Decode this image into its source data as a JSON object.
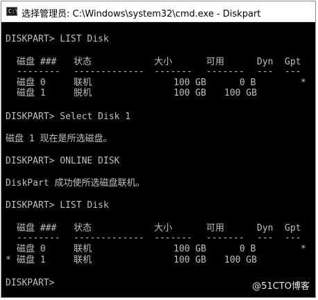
{
  "window": {
    "icon_text": "C:\\",
    "title": "选择管理员: C:\\Windows\\system32\\cmd.exe - Diskpart"
  },
  "console": {
    "cmd1": "DISKPART> LIST Disk",
    "table1": {
      "headers": [
        "磁盘 ###",
        "状态",
        "大小",
        "可用",
        "Dyn",
        "Gpt"
      ],
      "separators": [
        "--------",
        "-------------",
        "-------",
        "-------",
        "---",
        "---"
      ],
      "rows": [
        {
          "sel": "",
          "disk": "磁盘 0",
          "status": "联机",
          "size": "100 GB",
          "free": "0 B",
          "dyn": "",
          "gpt": "*"
        },
        {
          "sel": "",
          "disk": "磁盘 1",
          "status": "脱机",
          "size": "100 GB",
          "free": "100 GB",
          "dyn": "",
          "gpt": ""
        }
      ]
    },
    "cmd2": "DISKPART> Select Disk 1",
    "msg2": "磁盘 1 现在是所选磁盘。",
    "cmd3": "DISKPART> ONLINE DISK",
    "msg3": "DiskPart 成功使所选磁盘联机。",
    "cmd4": "DISKPART> LIST Disk",
    "table2": {
      "headers": [
        "磁盘 ###",
        "状态",
        "大小",
        "可用",
        "Dyn",
        "Gpt"
      ],
      "separators": [
        "--------",
        "-------------",
        "-------",
        "-------",
        "---",
        "---"
      ],
      "rows": [
        {
          "sel": "",
          "disk": "磁盘 0",
          "status": "联机",
          "size": "100 GB",
          "free": "0 B",
          "dyn": "",
          "gpt": "*"
        },
        {
          "sel": "*",
          "disk": "磁盘 1",
          "status": "联机",
          "size": "100 GB",
          "free": "100 GB",
          "dyn": "",
          "gpt": ""
        }
      ]
    },
    "prompt": "DISKPART>"
  },
  "watermark": "@51CTO博客"
}
